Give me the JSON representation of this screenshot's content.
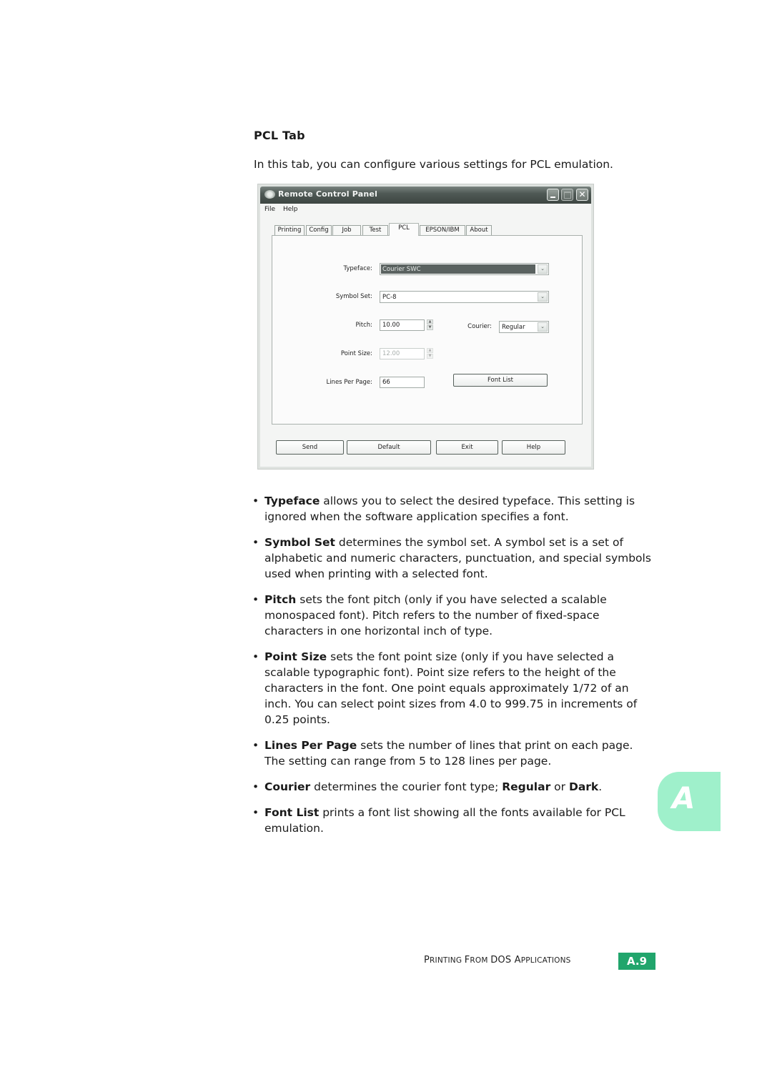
{
  "document": {
    "heading": "PCL Tab",
    "intro": "In this tab, you can configure various settings for PCL emulation."
  },
  "window": {
    "title": "Remote Control Panel",
    "menu": [
      "File",
      "Help"
    ],
    "tabs": [
      {
        "label": "Printing",
        "active": false
      },
      {
        "label": "Config",
        "active": false
      },
      {
        "label": "Job",
        "active": false
      },
      {
        "label": "Test",
        "active": false
      },
      {
        "label": "PCL",
        "active": true
      },
      {
        "label": "EPSON/IBM",
        "active": false
      },
      {
        "label": "About",
        "active": false
      }
    ],
    "fields": {
      "typeface": {
        "label": "Typeface:",
        "value": "Courier SWC"
      },
      "symbol_set": {
        "label": "Symbol Set:",
        "value": "PC-8"
      },
      "pitch": {
        "label": "Pitch:",
        "value": "10.00"
      },
      "courier": {
        "label": "Courier:",
        "value": "Regular"
      },
      "point_size": {
        "label": "Point Size:",
        "value": "12.00",
        "disabled": true
      },
      "lines_per_page": {
        "label": "Lines Per Page:",
        "value": "66"
      }
    },
    "font_list_label": "Font List",
    "buttons": {
      "send": "Send",
      "default": "Default",
      "exit": "Exit",
      "help": "Help"
    },
    "icons": {
      "chevron": "⌄",
      "spin_up": "▲",
      "spin_down": "▼",
      "close": "✕"
    }
  },
  "bullets": [
    {
      "term": "Typeface",
      "text": " allows you to select the desired typeface. This setting is ignored when the software application specifies a font."
    },
    {
      "term": "Symbol Set",
      "text": " determines the symbol set. A symbol set is a set of alphabetic and numeric characters, punctuation, and special symbols used when printing with a selected font."
    },
    {
      "term": "Pitch",
      "text": " sets the font pitch (only if you have selected a scalable monospaced font). Pitch refers to the number of fixed-space characters in one horizontal inch of type."
    },
    {
      "term": "Point Size",
      "text": " sets the font point size (only if you have selected a scalable typographic font). Point size refers to the height of the characters in the font. One point equals approximately 1/72 of an inch. You can select point sizes from 4.0 to 999.75 in increments of 0.25 points."
    },
    {
      "term": "Lines Per Page",
      "text": " sets the number of lines that print on each page. The setting can range from 5 to 128 lines per page."
    },
    {
      "term": "Courier",
      "text": " determines the courier font type; ",
      "term2": "Regular",
      "mid": " or ",
      "term3": "Dark",
      "end": "."
    },
    {
      "term": "Font List",
      "text": " prints a font list showing all the fonts available for PCL emulation."
    }
  ],
  "bullet_glyph": "•",
  "chapter_tab": "A",
  "footer": {
    "section_parts": [
      {
        "cap": "P",
        "rest": "RINTING "
      },
      {
        "cap": "F",
        "rest": "ROM "
      },
      {
        "cap": "DOS ",
        "rest": ""
      },
      {
        "cap": "A",
        "rest": "PPLICATIONS"
      }
    ],
    "page": "A.9",
    "accent_color": "#21a56c",
    "tab_color": "#9ff0cb"
  }
}
